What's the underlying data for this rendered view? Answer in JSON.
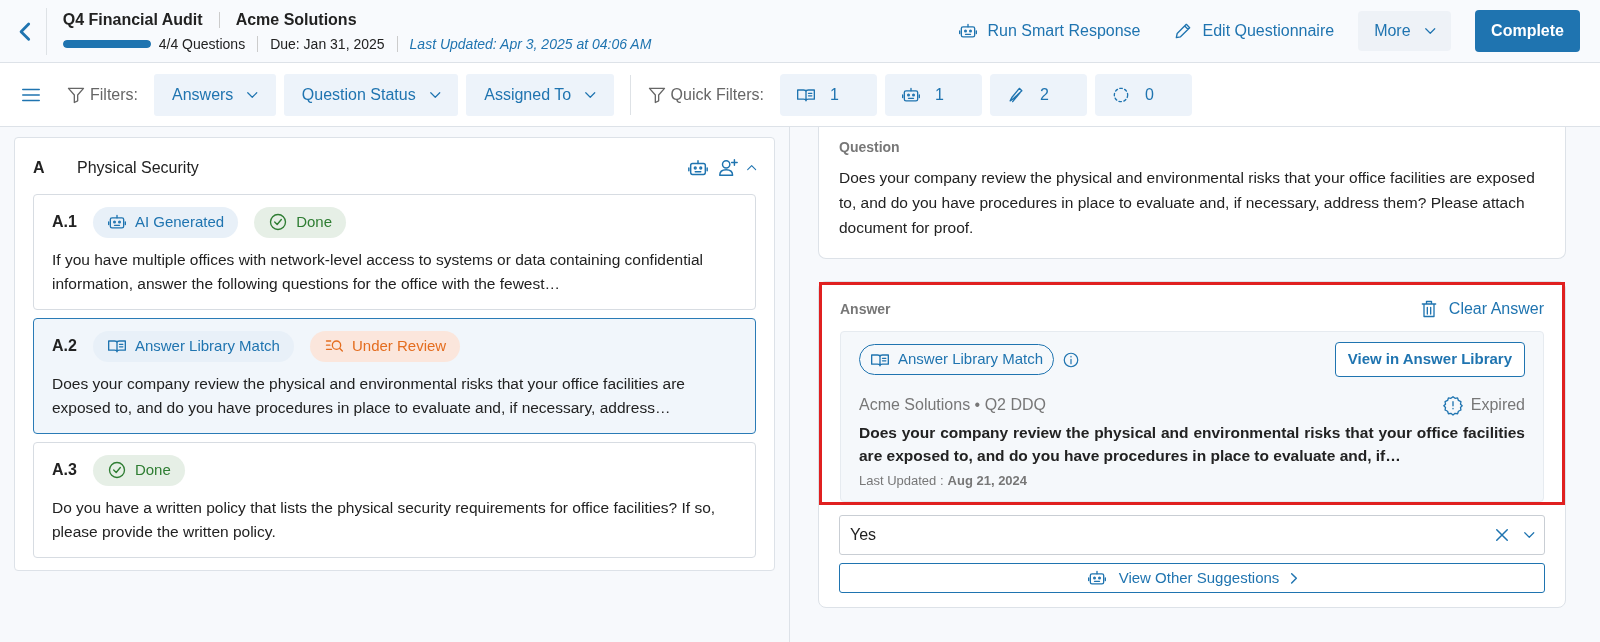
{
  "header": {
    "title": "Q4 Financial Audit",
    "client": "Acme Solutions",
    "progress": {
      "level": 1,
      "label": "4/4 Questions"
    },
    "due": "Due: Jan 31, 2025",
    "last_updated": "Last Updated: Apr 3, 2025 at 04:06 AM",
    "actions": [
      {
        "kind": "robot",
        "label": "Run Smart Response"
      },
      {
        "kind": "pencil",
        "label": "Edit Questionnaire"
      }
    ],
    "more": "More",
    "complete": "Complete"
  },
  "filters": {
    "label": "Filters:",
    "dropdowns": [
      "Answers",
      "Question Status",
      "Assigned To"
    ],
    "quick_label": "Quick Filters:",
    "quick": [
      {
        "kind": "book",
        "count": "1"
      },
      {
        "kind": "robot",
        "count": "1"
      },
      {
        "kind": "pencil",
        "count": "2"
      },
      {
        "kind": "dashed",
        "count": "0"
      }
    ]
  },
  "section": {
    "letter": "A",
    "title": "Physical Security",
    "expanded": true,
    "questions": [
      {
        "number": "A.1",
        "selected": false,
        "badges": [
          {
            "kind": "ai",
            "label": "AI Generated"
          },
          {
            "kind": "done",
            "label": "Done"
          }
        ],
        "text": "If you have multiple offices with network-level access to systems or data containing confidential information, answer the following questions for the office with the fewest…"
      },
      {
        "number": "A.2",
        "selected": true,
        "badges": [
          {
            "kind": "library",
            "label": "Answer Library Match"
          },
          {
            "kind": "review",
            "label": "Under Review"
          }
        ],
        "text": "Does your company review the physical and environmental risks that your office facilities are exposed to, and do you have procedures in place to evaluate and, if necessary, address…"
      },
      {
        "number": "A.3",
        "selected": false,
        "badges": [
          {
            "kind": "done",
            "label": "Done"
          }
        ],
        "text": "Do you have a written policy that lists the physical security requirements for office facilities? If so, please provide the written policy."
      }
    ]
  },
  "question": {
    "label": "Question",
    "text": "Does your company review the physical and environmental risks that your office facilities are exposed to, and do you have procedures in place to evaluate and, if necessary, address them? Please attach document for proof."
  },
  "answer": {
    "label": "Answer",
    "highlighted": true,
    "clear": "Clear Answer",
    "match": {
      "badge": "Answer Library Match",
      "view_button": "View in Answer Library",
      "source": "Acme Solutions • Q2 DDQ",
      "status": "Expired",
      "text": "Does your company review the physical and environmental risks that your office facilities are exposed to, and do you have procedures in place to evaluate and, if…",
      "updated_label": "Last Updated :",
      "updated_date": "Aug 21, 2024"
    },
    "value": "Yes",
    "suggestions": "View Other Suggestions"
  }
}
